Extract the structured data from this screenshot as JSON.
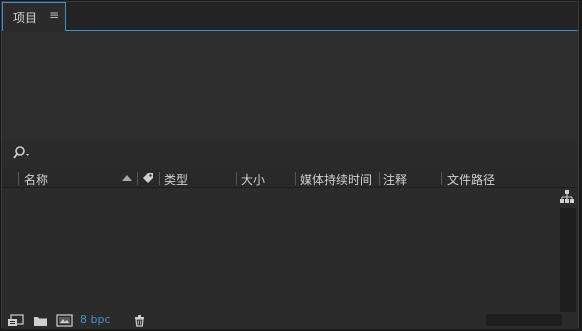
{
  "panel": {
    "tab_label": "项目",
    "tab_menu_glyph": "≡",
    "accent_color": "#3c8fd0"
  },
  "search": {
    "icon": "search-icon"
  },
  "columns": {
    "name": "名称",
    "type": "类型",
    "size": "大小",
    "duration": "媒体持续时间",
    "comment": "注释",
    "path": "文件路径"
  },
  "footer": {
    "bit_depth": "8 bpc",
    "icons": [
      "interpret-footage-icon",
      "new-folder-icon",
      "new-composition-icon",
      "delete-icon"
    ]
  }
}
